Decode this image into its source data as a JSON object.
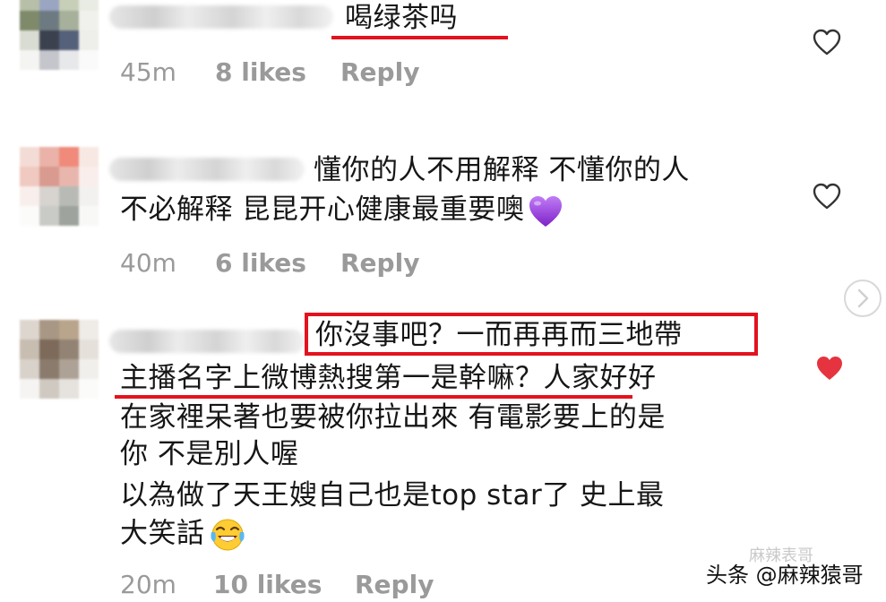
{
  "comments": [
    {
      "lines": [
        "喝绿茶吗"
      ],
      "time": "45m",
      "likes": "8 likes",
      "reply": "Reply",
      "liked": false
    },
    {
      "lines": [
        "懂你的人不用解释 不懂你的人",
        "不必解释 昆昆开心健康最重要噢"
      ],
      "emoji": "purple-heart",
      "time": "40m",
      "likes": "6 likes",
      "reply": "Reply",
      "liked": false
    },
    {
      "lines": [
        "你沒事吧？一而再再而三地帶",
        "主播名字上微博熱搜第一是幹嘛？人家好好",
        "在家裡呆著也要被你拉出來 有電影要上的是",
        "你 不是別人喔",
        "以為做了天王嫂自己也是top star了 史上最",
        "大笑話"
      ],
      "emoji": "laughing-tears",
      "time": "20m",
      "likes": "10 likes",
      "reply": "Reply",
      "liked": true
    }
  ],
  "watermark": {
    "text": "头条 @麻辣猿哥",
    "faint": "麻辣表哥"
  },
  "colors": {
    "highlight": "#e3121e",
    "meta": "#9a9a9a",
    "liked_heart": "#e5343f",
    "purple_heart": "#9b3fe0"
  }
}
